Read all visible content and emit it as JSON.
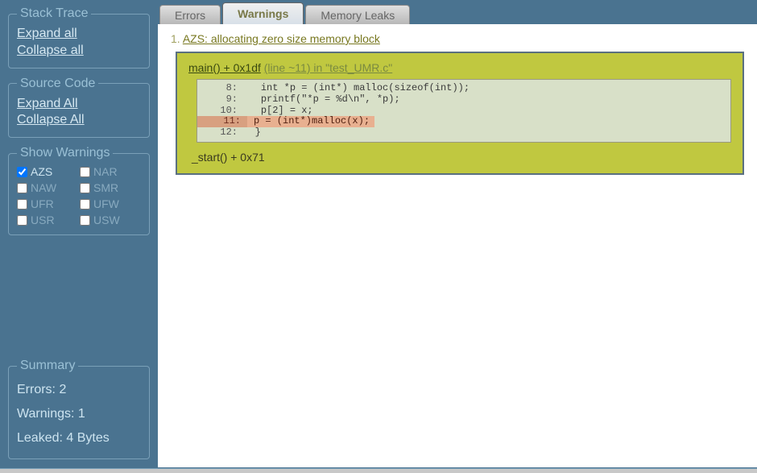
{
  "sidebar": {
    "stack_trace": {
      "legend": "Stack Trace",
      "expand": "Expand all",
      "collapse": "Collapse all"
    },
    "source_code": {
      "legend": "Source Code",
      "expand": "Expand All",
      "collapse": "Collapse All"
    },
    "show_warnings": {
      "legend": "Show Warnings",
      "items": [
        {
          "label": "AZS",
          "checked": true
        },
        {
          "label": "NAR",
          "checked": false
        },
        {
          "label": "NAW",
          "checked": false
        },
        {
          "label": "SMR",
          "checked": false
        },
        {
          "label": "UFR",
          "checked": false
        },
        {
          "label": "UFW",
          "checked": false
        },
        {
          "label": "USR",
          "checked": false
        },
        {
          "label": "USW",
          "checked": false
        }
      ]
    },
    "summary": {
      "legend": "Summary",
      "errors": "Errors: 2",
      "warnings": "Warnings: 1",
      "leaked": "Leaked: 4 Bytes"
    }
  },
  "tabs": {
    "errors": "Errors",
    "warnings": "Warnings",
    "memory_leaks": "Memory Leaks"
  },
  "warning": {
    "num": "1.",
    "title": "AZS: allocating zero size memory block",
    "frame_top_main": "main() + 0x1df",
    "frame_top_info": "(line ~11) in \"test_UMR.c\"",
    "code": {
      "l8": "int *p = (int*) malloc(sizeof(int));",
      "l9": "printf(\"*p = %d\\n\", *p);",
      "l10": "p[2] = x;",
      "l11": "p = (int*)malloc(x);",
      "l12": "}"
    },
    "frame_bottom": "_start() + 0x71"
  }
}
